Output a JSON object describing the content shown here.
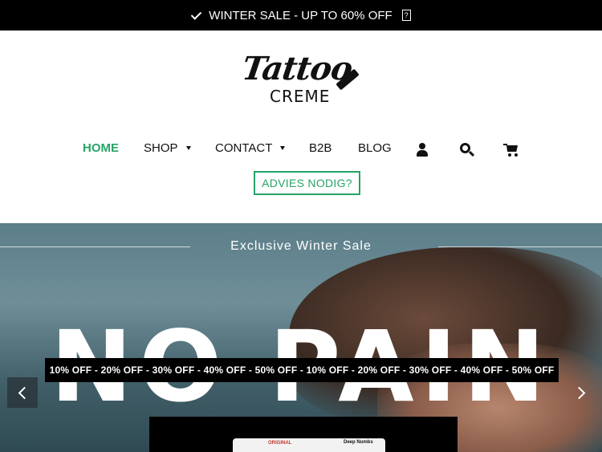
{
  "announcement": {
    "text": "WINTER SALE - UP TO 60% OFF",
    "icon": "check-icon"
  },
  "logo": {
    "script": "Tattoo",
    "sub": "CREME"
  },
  "nav": {
    "items": [
      {
        "label": "HOME",
        "active": true,
        "dropdown": false
      },
      {
        "label": "SHOP",
        "active": false,
        "dropdown": true
      },
      {
        "label": "CONTACT",
        "active": false,
        "dropdown": true
      },
      {
        "label": "B2B",
        "active": false,
        "dropdown": false
      },
      {
        "label": "BLOG",
        "active": false,
        "dropdown": false
      }
    ],
    "icons": [
      "user-icon",
      "search-icon",
      "cart-icon"
    ],
    "cta": "ADVIES NODIG?"
  },
  "hero": {
    "subtitle": "Exclusive Winter Sale",
    "headline": "NO PAIN",
    "discount_strip": "10% OFF - 20% OFF - 30% OFF - 40% OFF - 50% OFF - 10% OFF - 20% OFF - 30% OFF - 40% OFF - 50% OFF",
    "product_label_red": "ORIGINAL",
    "product_label": "Deep Numbs"
  },
  "colors": {
    "accent": "#27a367",
    "topbar": "#000000"
  }
}
